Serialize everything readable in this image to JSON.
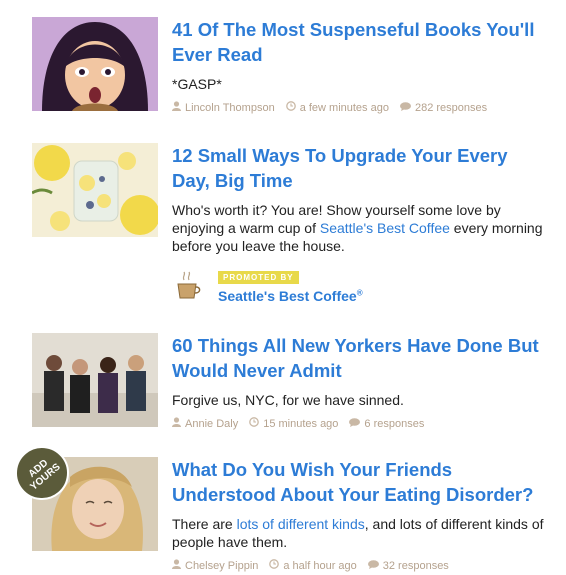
{
  "articles": [
    {
      "title": "41 Of The Most Suspenseful Books You'll Ever Read",
      "description": "*GASP*",
      "author": "Lincoln Thompson",
      "time": "a few minutes ago",
      "responses": "282 responses"
    },
    {
      "title": "12 Small Ways To Upgrade Your Every Day, Big Time",
      "description_before": "Who's worth it? You are! Show yourself some love by enjoying a warm cup of ",
      "description_link": "Seattle's Best Coffee",
      "description_after": " every morning before you leave the house.",
      "promoted_label": "PROMOTED BY",
      "promoted_name": "Seattle's Best Coffee",
      "promoted_reg": "®"
    },
    {
      "title": "60 Things All New Yorkers Have Done But Would Never Admit",
      "description": "Forgive us, NYC, for we have sinned.",
      "author": "Annie Daly",
      "time": "15 minutes ago",
      "responses": "6 responses"
    },
    {
      "title": "What Do You Wish Your Friends Understood About Your Eating Disorder?",
      "description_before": "There are ",
      "description_link": "lots of different kinds",
      "description_after": ", and lots of different kinds of people have them.",
      "author": "Chelsey Pippin",
      "time": "a half hour ago",
      "responses": "32 responses",
      "badge": "ADD YOURS"
    }
  ],
  "colors": {
    "link": "#2d7cd6",
    "meta": "#b5a28e",
    "promo_tag": "#e8d94a",
    "badge": "#5b5b3a"
  }
}
